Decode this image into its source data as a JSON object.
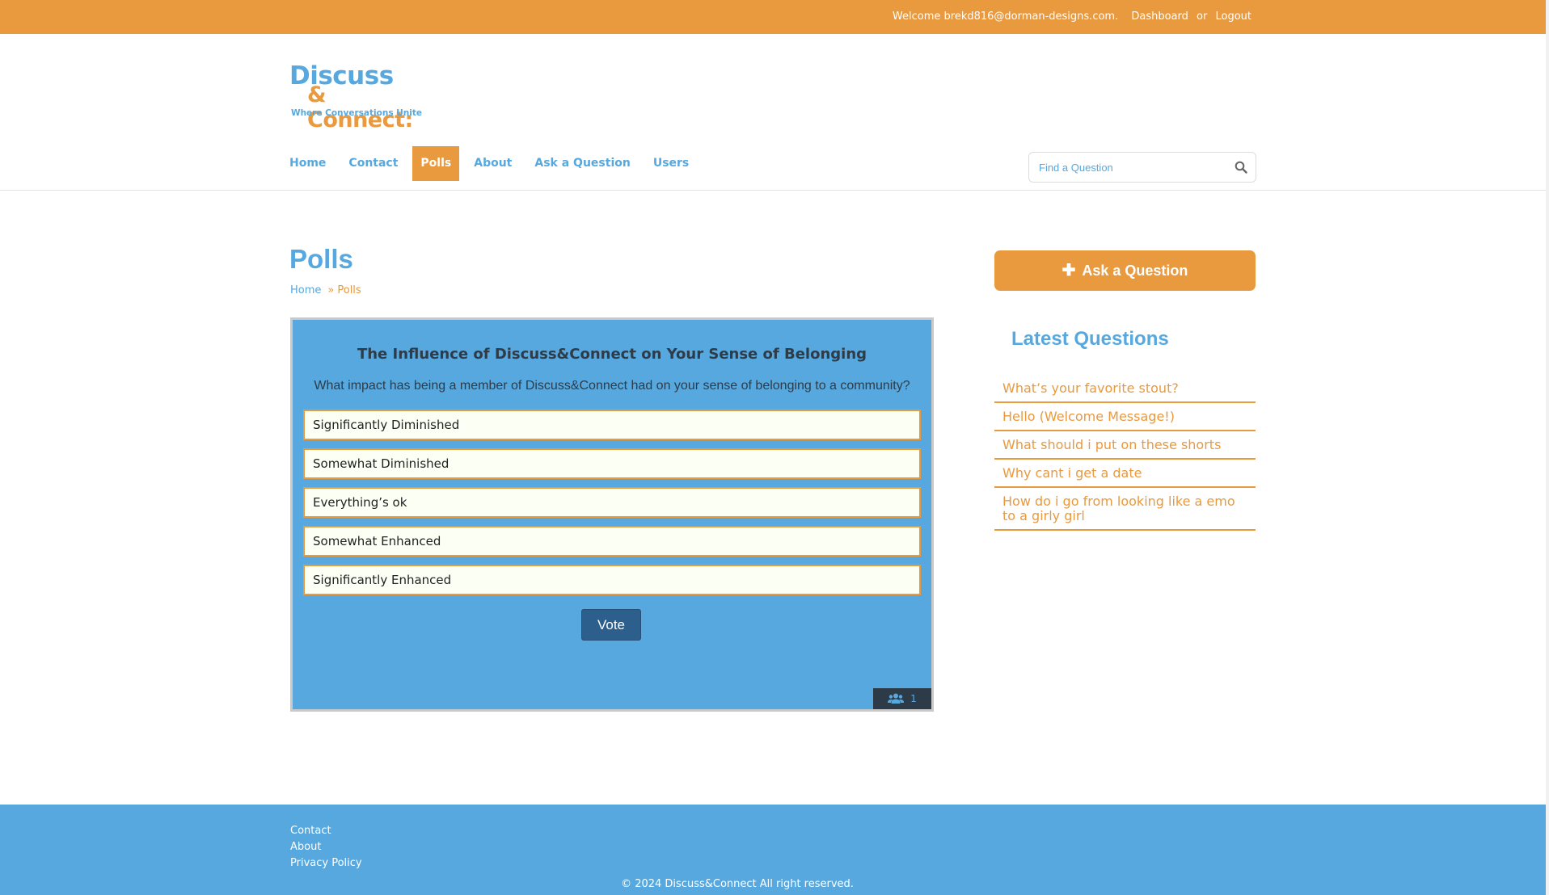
{
  "topbar": {
    "welcome_text": "Welcome brekd816@dorman-designs.com.",
    "dashboard_label": "Dashboard",
    "or_text": "or",
    "logout_label": "Logout"
  },
  "logo": {
    "line1": "Discuss",
    "line2": "& Connect:",
    "tagline": "Where Conversations Unite"
  },
  "nav": {
    "items": [
      {
        "label": "Home"
      },
      {
        "label": "Contact"
      },
      {
        "label": "Polls",
        "active": true
      },
      {
        "label": "About"
      },
      {
        "label": "Ask a Question"
      },
      {
        "label": "Users"
      }
    ]
  },
  "search": {
    "placeholder": "Find a Question",
    "icon": "search-icon"
  },
  "main": {
    "title": "Polls",
    "breadcrumb": {
      "home": "Home",
      "separator": "»",
      "current": "Polls"
    }
  },
  "poll": {
    "title": "The Influence of Discuss&Connect on Your Sense of Belonging",
    "question": "What impact has being a member of Discuss&Connect had on your sense of belonging to a community?",
    "options": [
      "Significantly Diminished",
      "Somewhat Diminished",
      "Everything’s ok",
      "Somewhat Enhanced",
      "Significantly Enhanced"
    ],
    "vote_label": "Vote",
    "voter_count": "1",
    "voter_icon": "users-icon"
  },
  "sidebar": {
    "ask_button_label": "Ask a Question",
    "ask_button_icon": "plus-icon",
    "latest_title": "Latest Questions",
    "latest_questions": [
      "What’s your favorite stout?",
      "Hello (Welcome Message!)",
      "What should i put on these shorts",
      "Why cant i get a date",
      "How do i go from looking like a emo to a girly girl"
    ]
  },
  "footer": {
    "links": [
      "Contact",
      "About",
      "Privacy Policy"
    ],
    "copyright": "© 2024 Discuss&Connect All right reserved."
  },
  "colors": {
    "orange": "#e9993e",
    "blue": "#56a8de",
    "dark_button": "#2d5f8c",
    "option_bg": "#fcfff4"
  }
}
